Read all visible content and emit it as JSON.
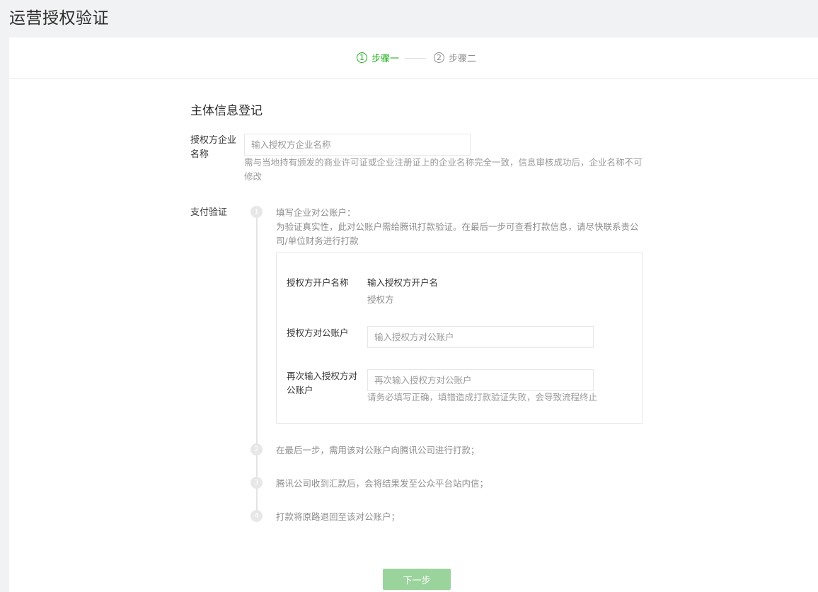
{
  "page": {
    "title": "运营授权验证"
  },
  "stepper": {
    "step1": {
      "num": "1",
      "label": "步骤一"
    },
    "step2": {
      "num": "2",
      "label": "步骤二"
    }
  },
  "form": {
    "section_title": "主体信息登记",
    "company_label": "授权方企业名称",
    "company_placeholder": "输入授权方企业名称",
    "company_tip": "需与当地持有颁发的商业许可证或企业注册证上的企业名称完全一致，信息审核成功后，企业名称不可修改",
    "payment_label": "支付验证"
  },
  "payment_steps": [
    {
      "num": "1",
      "title": "填写企业对公账户：",
      "desc": "为验证真实性，此对公账户需给腾讯打款验证。在最后一步可查看打款信息，请尽快联系贵公司/单位财务进行打款"
    },
    {
      "num": "2",
      "text": "在最后一步，需用该对公账户向腾讯公司进行打款；"
    },
    {
      "num": "3",
      "text": "腾讯公司收到汇款后，会将结果发至公众平台站内信；"
    },
    {
      "num": "4",
      "text": "打款将原路退回至该对公账户；"
    }
  ],
  "account_box": {
    "holder_label": "授权方开户名称",
    "holder_value": "输入授权方开户名",
    "holder_sub": "授权方",
    "account_label": "授权方对公账户",
    "account_placeholder": "输入授权方对公账户",
    "confirm_label": "再次输入授权方对公账户",
    "confirm_placeholder": "再次输入授权方对公账户",
    "confirm_tip": "请务必填写正确，填错造成打款验证失败，会导致流程终止"
  },
  "footer": {
    "next_label": "下一步"
  }
}
